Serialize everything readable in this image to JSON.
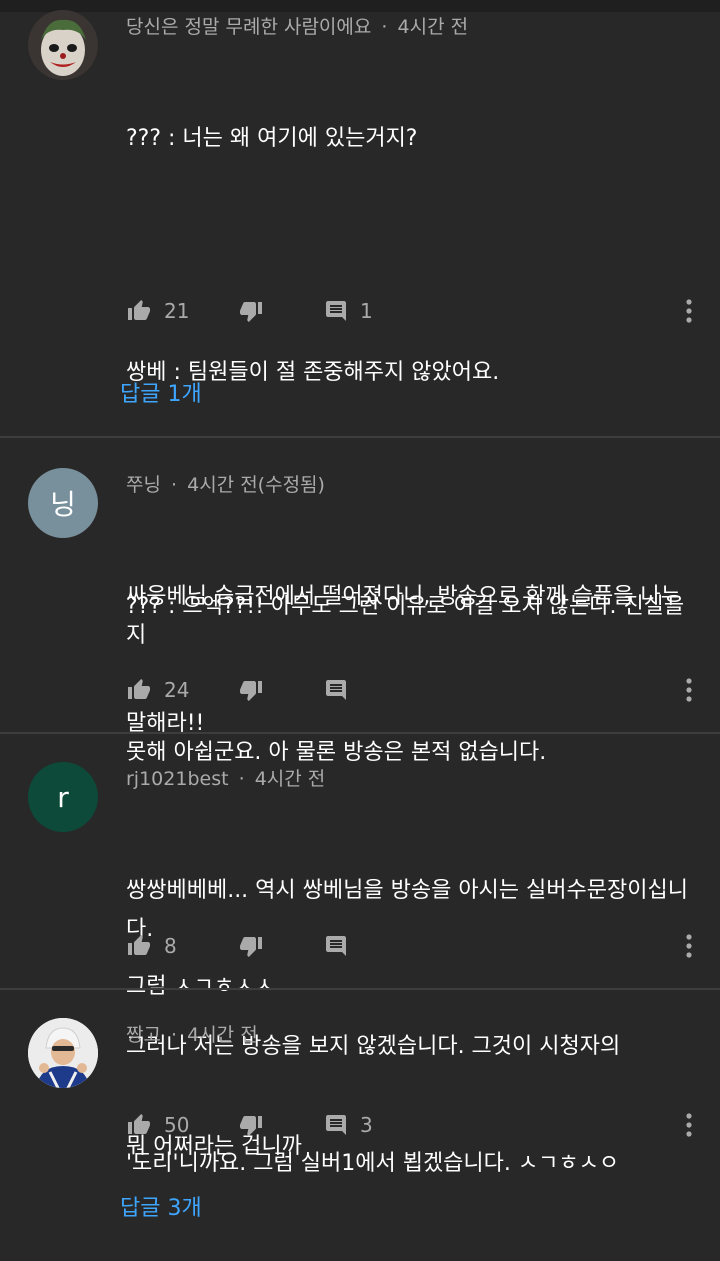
{
  "comments": [
    {
      "author": "당신은 정말 무례한 사람이에요",
      "time": "4시간 전",
      "lines": [
        "??? : 너는 왜 여기에 있는거지?",
        "",
        "쌍베 : 팀원들이 절 존중해주지 않았어요.",
        "",
        "??? : 으엑??!! 아무도 그런 이유로 여길 오지 않는다. 진실을",
        "말해라!!"
      ],
      "likes": "21",
      "reply_count": "1",
      "replies_link": "답글 1개"
    },
    {
      "author": "쭈닝",
      "time": "4시간 전(수정됨)",
      "avatar_letter": "닝",
      "avatar_color": "#78909c",
      "lines": [
        "싸응베님 승급전에서 떨어졌다니, 방송으로 함께 슬픔을 나누지",
        "못해 아쉽군요. 아 물론 방송은 본적 없습니다.",
        "",
        "그럼 ㅅㄱㅎㅅㅅ"
      ],
      "likes": "24"
    },
    {
      "author": "rj1021best",
      "time": "4시간 전",
      "avatar_letter": "r",
      "avatar_color": "#0d4a39",
      "lines": [
        "쌍쌍베베베... 역시 쌍베님을 방송을 아시는 실버수문장이십니다.",
        "그러나 저는 방송을 보지 않겠습니다. 그것이 시청자의",
        "'도리'니까요. 그럼 실버1에서 뵙겠습니다. ㅅㄱㅎㅅㅇ"
      ],
      "likes": "8"
    },
    {
      "author": "짱고",
      "time": "4시간 전",
      "lines": [
        "뭐 어쩌라는 겁니까"
      ],
      "likes": "50",
      "reply_count": "3",
      "replies_link": "답글 3개"
    }
  ],
  "meta_separator": "·",
  "icons": {
    "like": "thumbs-up-icon",
    "dislike": "thumbs-down-icon",
    "reply": "comment-icon",
    "more": "more-vertical-icon"
  },
  "colors": {
    "background": "#282828",
    "link": "#3ea6ff",
    "secondary_text": "#aaaaaa"
  }
}
